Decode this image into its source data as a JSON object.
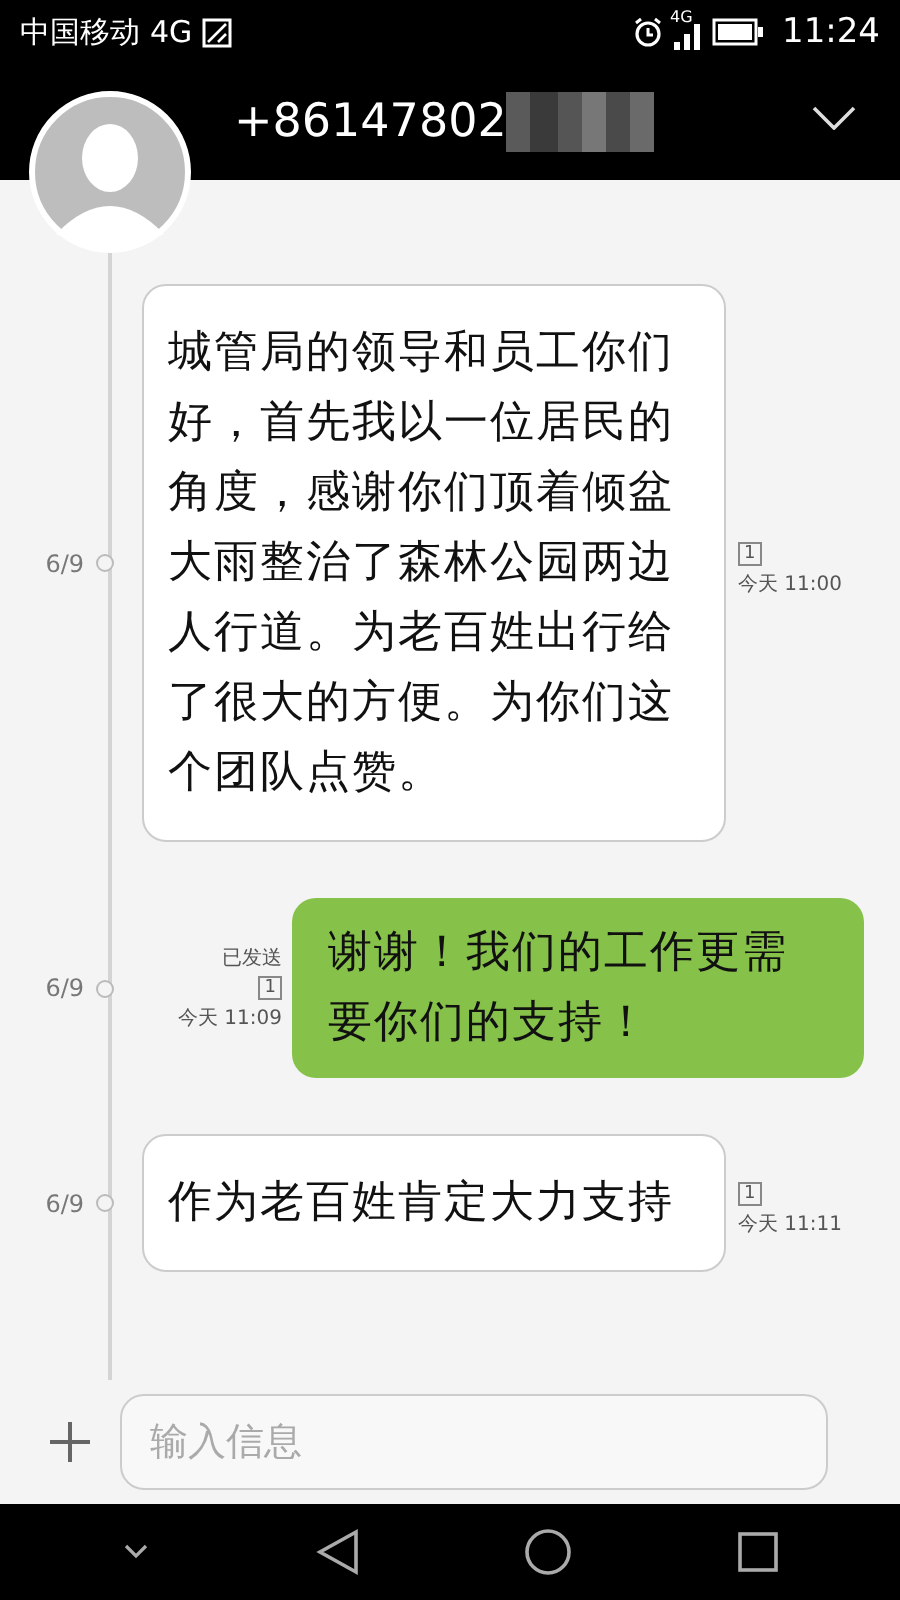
{
  "status_bar": {
    "carrier": "中国移动",
    "network": "4G",
    "signal_label": "4G",
    "time": "11:24"
  },
  "header": {
    "phone_number": "+86147802"
  },
  "messages": [
    {
      "kind": "incoming",
      "date": "6/9",
      "text": "城管局的领导和员工你们好，首先我以一位居民的角度，感谢你们顶着倾盆大雨整治了森林公园两边人行道。为老百姓出行给了很大的方便。为你们这个团队点赞。",
      "sim": "1",
      "time": "今天 11:00"
    },
    {
      "kind": "outgoing",
      "date": "6/9",
      "status": "已发送",
      "text": "谢谢！我们的工作更需要你们的支持！",
      "sim": "1",
      "time": "今天 11:09"
    },
    {
      "kind": "incoming",
      "date": "6/9",
      "text": "作为老百姓肯定大力支持",
      "sim": "1",
      "time": "今天 11:11"
    }
  ],
  "composer": {
    "placeholder": "输入信息"
  }
}
